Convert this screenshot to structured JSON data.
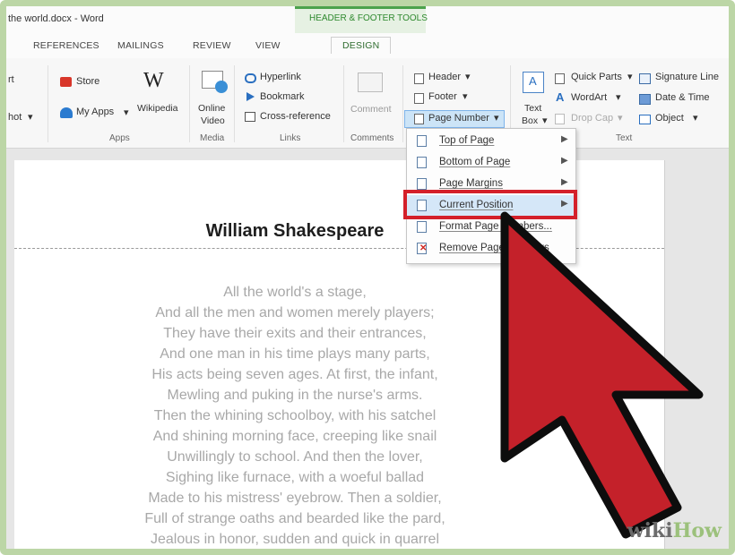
{
  "window": {
    "title": "the world.docx - Word"
  },
  "context_tab": {
    "label": "HEADER & FOOTER TOOLS"
  },
  "tabs": [
    {
      "label": "REFERENCES"
    },
    {
      "label": "MAILINGS"
    },
    {
      "label": "REVIEW"
    },
    {
      "label": "VIEW"
    },
    {
      "label": "DESIGN"
    }
  ],
  "ribbon": {
    "partial_left_1": "rt",
    "partial_left_2": "hot",
    "store": "Store",
    "my_apps": "My Apps",
    "wikipedia": "Wikipedia",
    "online_video_1": "Online",
    "online_video_2": "Video",
    "hyperlink": "Hyperlink",
    "bookmark": "Bookmark",
    "cross_reference": "Cross-reference",
    "comment": "Comment",
    "header": "Header",
    "footer": "Footer",
    "page_number": "Page Number",
    "text_box_1": "Text",
    "text_box_2": "Box",
    "quick_parts": "Quick Parts",
    "wordart": "WordArt",
    "drop_cap": "Drop Cap",
    "signature_line": "Signature Line",
    "date_time": "Date & Time",
    "object": "Object",
    "groups": {
      "apps": "Apps",
      "media": "Media",
      "links": "Links",
      "comments": "Comments",
      "text": "Text"
    }
  },
  "page_number_menu": {
    "items": [
      {
        "label": "Top of Page"
      },
      {
        "label": "Bottom of Page"
      },
      {
        "label": "Page Margins"
      },
      {
        "label": "Current Position"
      },
      {
        "label": "Format Page Numbers..."
      },
      {
        "label": "Remove Page Numbers"
      }
    ]
  },
  "document": {
    "title": "William Shakespeare",
    "lines": [
      "All the world's a stage,",
      "And all the men and women merely players;",
      "They have their exits and their entrances,",
      "And one man in his time plays many parts,",
      "His acts being seven ages. At first, the infant,",
      "Mewling and puking in the nurse's arms.",
      "Then the whining schoolboy, with his satchel",
      "And shining morning face, creeping like snail",
      "Unwillingly to school. And then the lover,",
      "Sighing like furnace, with a woeful ballad",
      "Made to his mistress' eyebrow. Then a soldier,",
      "Full of strange oaths and bearded like the pard,",
      "Jealous in honor, sudden and quick in quarrel"
    ]
  },
  "watermark": {
    "wiki": "wiki",
    "how": "How"
  },
  "colors": {
    "accent_green": "#4ca24c",
    "highlight_red": "#d4202a",
    "menu_hover": "#d5e7f8"
  }
}
